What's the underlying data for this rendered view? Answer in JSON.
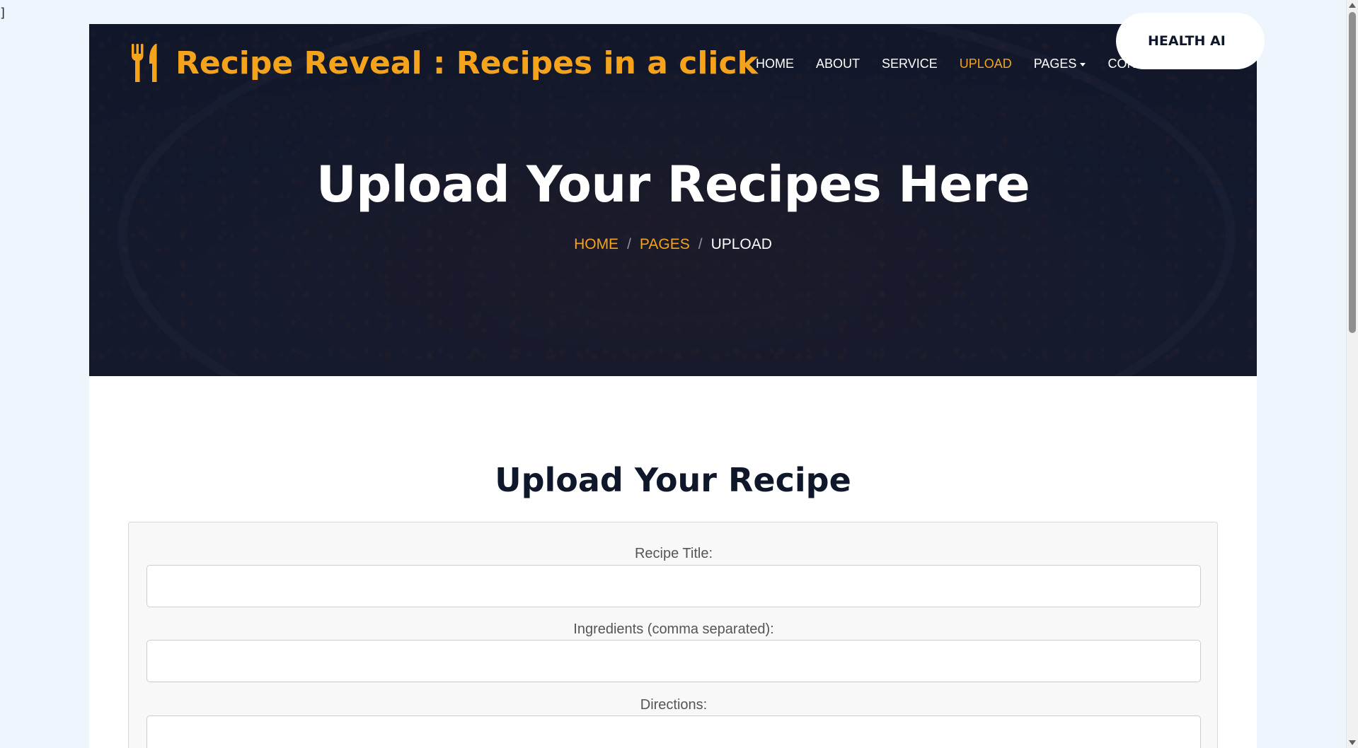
{
  "stray_char": "]",
  "brand": {
    "name": "Recipe Reveal : Recipes in a click",
    "icon": "utensils-icon",
    "color": "#f4a31a"
  },
  "nav": {
    "items": [
      {
        "label": "HOME",
        "active": false
      },
      {
        "label": "ABOUT",
        "active": false
      },
      {
        "label": "SERVICE",
        "active": false
      },
      {
        "label": "UPLOAD",
        "active": true
      },
      {
        "label": "PAGES",
        "active": false,
        "dropdown": true
      },
      {
        "label": "CONTACT",
        "active": false
      }
    ],
    "cta_label": "HEALTH AI"
  },
  "hero": {
    "title": "Upload Your Recipes Here",
    "breadcrumb": [
      "HOME",
      "PAGES",
      "UPLOAD"
    ],
    "breadcrumb_separator": "/"
  },
  "form": {
    "title": "Upload Your Recipe",
    "fields": [
      {
        "label": "Recipe Title:",
        "value": "",
        "placeholder": ""
      },
      {
        "label": "Ingredients (comma separated):",
        "value": "",
        "placeholder": ""
      },
      {
        "label": "Directions:",
        "value": "",
        "placeholder": ""
      }
    ]
  },
  "colors": {
    "accent": "#f4a31a",
    "dark_navy": "#0f172b",
    "page_background": "#eef5fc"
  }
}
